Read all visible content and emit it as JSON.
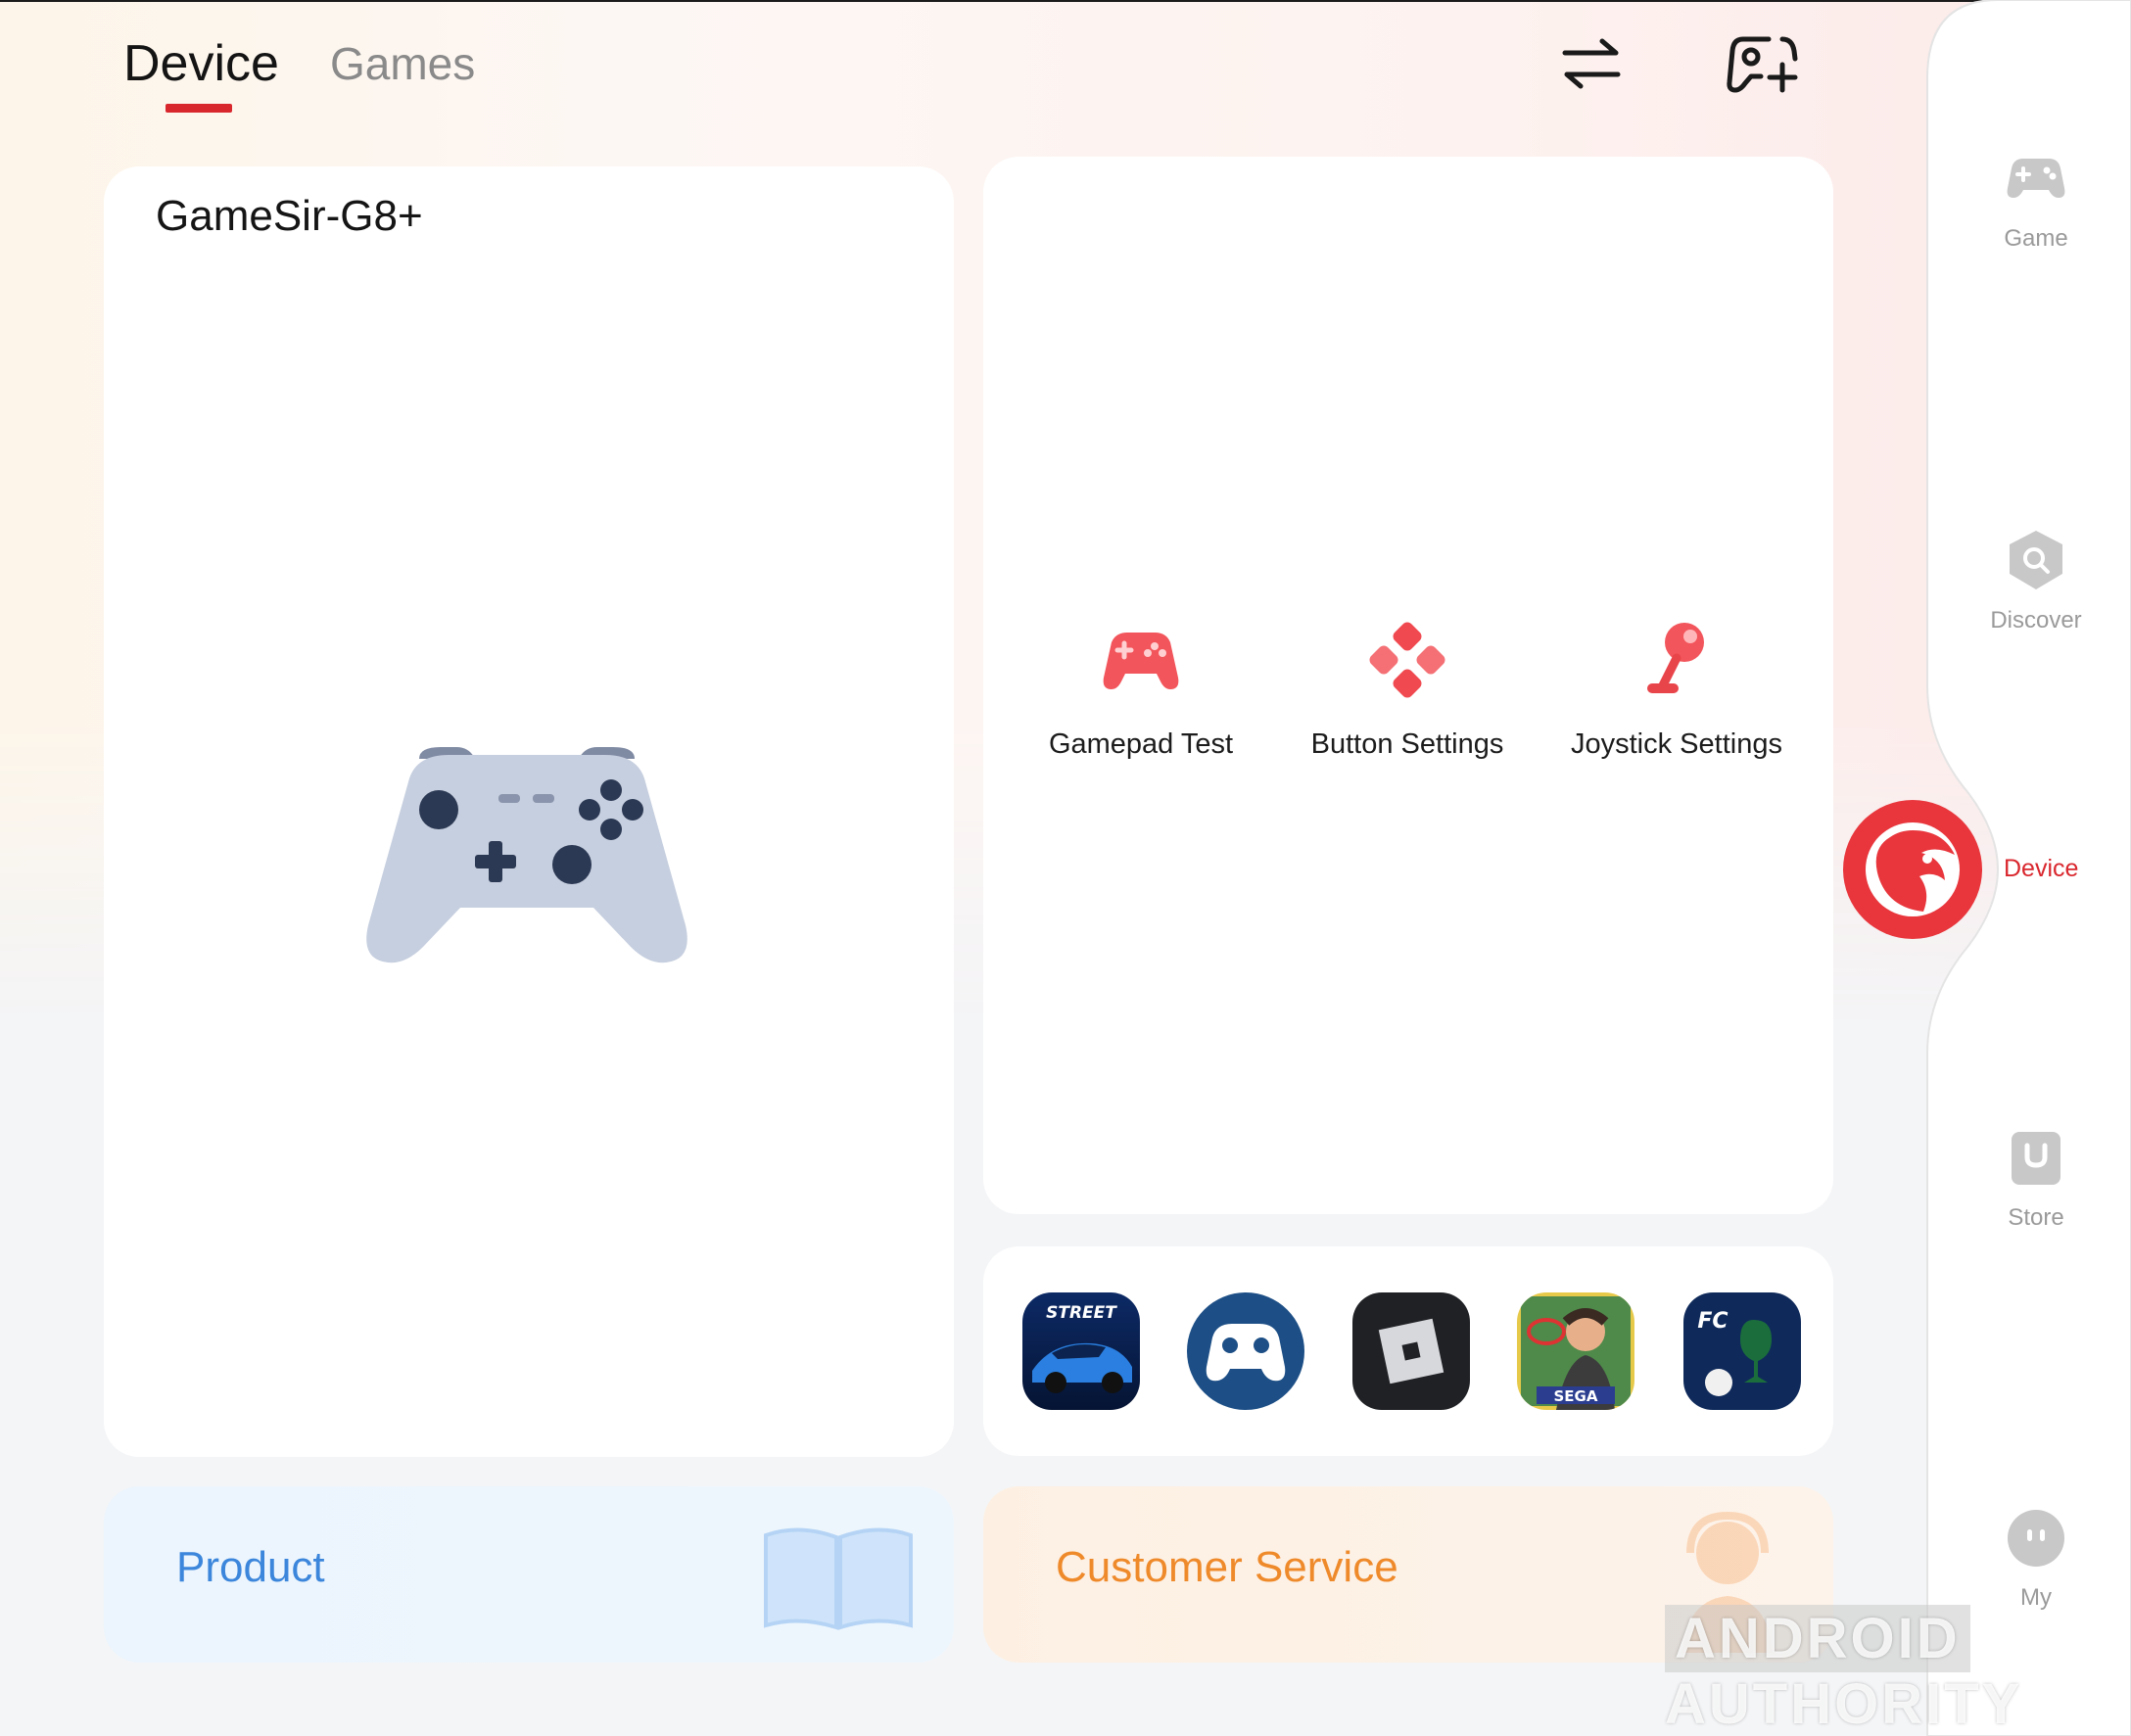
{
  "header": {
    "tabs": [
      {
        "label": "Device",
        "active": true
      },
      {
        "label": "Games",
        "active": false
      }
    ],
    "icons": [
      "swap-arrows-icon",
      "add-controller-icon"
    ]
  },
  "device_card": {
    "name": "GameSir-G8+",
    "image": "controller-icon"
  },
  "tools": [
    {
      "label": "Gamepad Test",
      "icon": "gamepad-icon"
    },
    {
      "label": "Button Settings",
      "icon": "dpad-icon"
    },
    {
      "label": "Joystick Settings",
      "icon": "joystick-icon"
    }
  ],
  "games": [
    {
      "icon": "street-racing-app-icon",
      "caption": "STREET"
    },
    {
      "icon": "gamesir-controller-app-icon"
    },
    {
      "icon": "roblox-app-icon"
    },
    {
      "icon": "virtua-tennis-app-icon",
      "caption": "SEGA"
    },
    {
      "icon": "ea-fc-app-icon",
      "caption": "FC"
    }
  ],
  "banners": {
    "product": "Product",
    "customer_service": "Customer Service"
  },
  "nav": {
    "items": [
      {
        "label": "Game",
        "icon": "gamepad-icon"
      },
      {
        "label": "Discover",
        "icon": "search-icon"
      },
      {
        "label": "Device",
        "icon": "gamesir-logo-icon",
        "active": true
      },
      {
        "label": "Store",
        "icon": "store-bag-icon"
      },
      {
        "label": "My",
        "icon": "profile-face-icon"
      }
    ]
  },
  "watermark": {
    "part1": "ANDROID",
    "part2": "AUTHORITY"
  },
  "colors": {
    "accent_red": "#d9272e",
    "product_blue": "#3c86dc",
    "service_orange": "#ef8a2b",
    "controller_grey": "#c6cfdf"
  }
}
